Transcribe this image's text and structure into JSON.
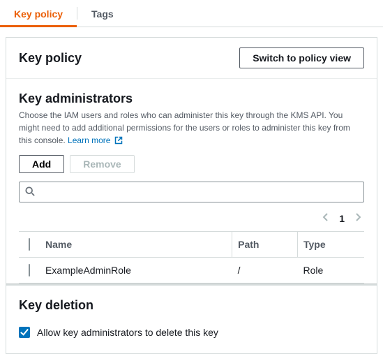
{
  "tabs": {
    "keyPolicy": "Key policy",
    "tags": "Tags"
  },
  "header": {
    "title": "Key policy",
    "switchBtn": "Switch to policy view"
  },
  "admins": {
    "title": "Key administrators",
    "desc": "Choose the IAM users and roles who can administer this key through the KMS API. You might need to add additional permissions for the users or roles to administer this key from this console. ",
    "learnMore": "Learn more",
    "addBtn": "Add",
    "removeBtn": "Remove",
    "searchValue": "",
    "page": "1",
    "columns": {
      "name": "Name",
      "path": "Path",
      "type": "Type"
    },
    "rows": [
      {
        "name": "ExampleAdminRole",
        "path": "/",
        "type": "Role"
      }
    ]
  },
  "deletion": {
    "title": "Key deletion",
    "checkboxLabel": "Allow key administrators to delete this key"
  }
}
